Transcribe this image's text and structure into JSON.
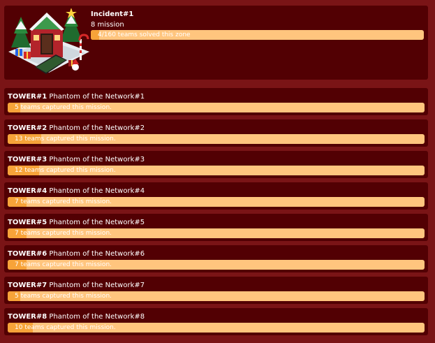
{
  "zone": {
    "title": "Incident#1",
    "missions_text": "8 mission",
    "progress_text": "4/160 teams solved this zone",
    "progress_fraction": 0.025,
    "image_icon": "christmas-house-icon"
  },
  "missions": [
    {
      "tower": "TOWER#1",
      "name": "Phantom of the Network#1",
      "progress_text": "5 teams captured this mission.",
      "progress_fraction": 0.03
    },
    {
      "tower": "TOWER#2",
      "name": "Phantom of the Network#2",
      "progress_text": "13 teams captured this mission.",
      "progress_fraction": 0.08
    },
    {
      "tower": "TOWER#3",
      "name": "Phantom of the Network#3",
      "progress_text": "12 teams captured this mission.",
      "progress_fraction": 0.075
    },
    {
      "tower": "TOWER#4",
      "name": "Phantom of the Network#4",
      "progress_text": "7 teams captured this mission.",
      "progress_fraction": 0.045
    },
    {
      "tower": "TOWER#5",
      "name": "Phantom of the Network#5",
      "progress_text": "7 teams captured this mission.",
      "progress_fraction": 0.045
    },
    {
      "tower": "TOWER#6",
      "name": "Phantom of the Network#6",
      "progress_text": "7 teams captured this mission.",
      "progress_fraction": 0.045
    },
    {
      "tower": "TOWER#7",
      "name": "Phantom of the Network#7",
      "progress_text": "5 teams captured this mission.",
      "progress_fraction": 0.03
    },
    {
      "tower": "TOWER#8",
      "name": "Phantom of the Network#8",
      "progress_text": "10 teams captured this mission.",
      "progress_fraction": 0.06
    }
  ],
  "colors": {
    "page_background": "#7a1416",
    "card_background": "#520003",
    "bar_track": "#ffc57e",
    "bar_fill": "#f7a339"
  }
}
